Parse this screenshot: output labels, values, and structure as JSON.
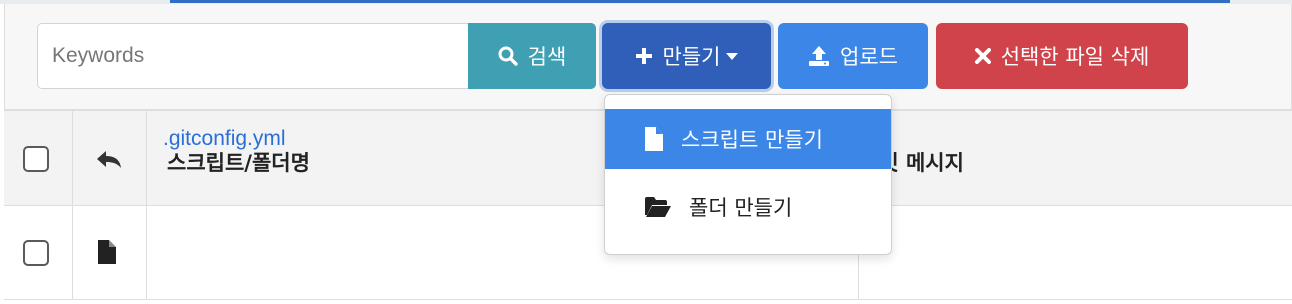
{
  "search": {
    "placeholder": "Keywords",
    "button_label": "검색"
  },
  "toolbar": {
    "create_label": "만들기",
    "upload_label": "업로드",
    "delete_label": "선택한 파일 삭제"
  },
  "dropdown": {
    "items": [
      {
        "label": "스크립트 만들기",
        "icon": "file-icon",
        "active": true
      },
      {
        "label": "폴더 만들기",
        "icon": "folder-open-icon",
        "active": false
      }
    ]
  },
  "table": {
    "headers": {
      "name": "스크립트/폴더명",
      "commit_message": "커밋 메시지"
    },
    "rows": [
      {
        "name": ".gitconfig.yml",
        "type": "file"
      }
    ]
  },
  "colors": {
    "search_button": "#3fa0b3",
    "create_button": "#2f5fb8",
    "upload_button": "#3b86e6",
    "delete_button": "#d1434a",
    "link": "#2a6fd6"
  }
}
